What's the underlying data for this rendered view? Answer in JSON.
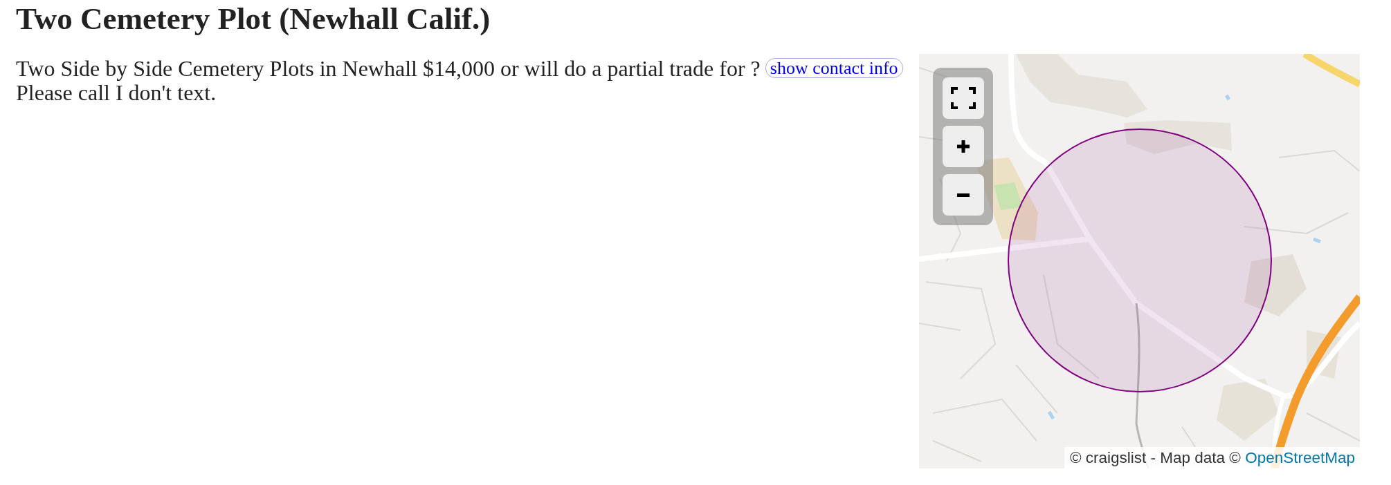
{
  "title": "Two Cemetery Plot (Newhall Calif.)",
  "posting": {
    "text_before": "Two Side by Side Cemetery Plots in Newhall $14,000 or will do a partial trade for ?",
    "contact_button": "show contact info",
    "text_after": "Please call I don't text."
  },
  "map": {
    "controls": [
      {
        "kind": "fullscreen"
      },
      {
        "kind": "zoom_in"
      },
      {
        "kind": "zoom_out"
      }
    ],
    "attribution": {
      "text": "© craigslist - Map data ©",
      "link": "OpenStreetMap"
    }
  }
}
